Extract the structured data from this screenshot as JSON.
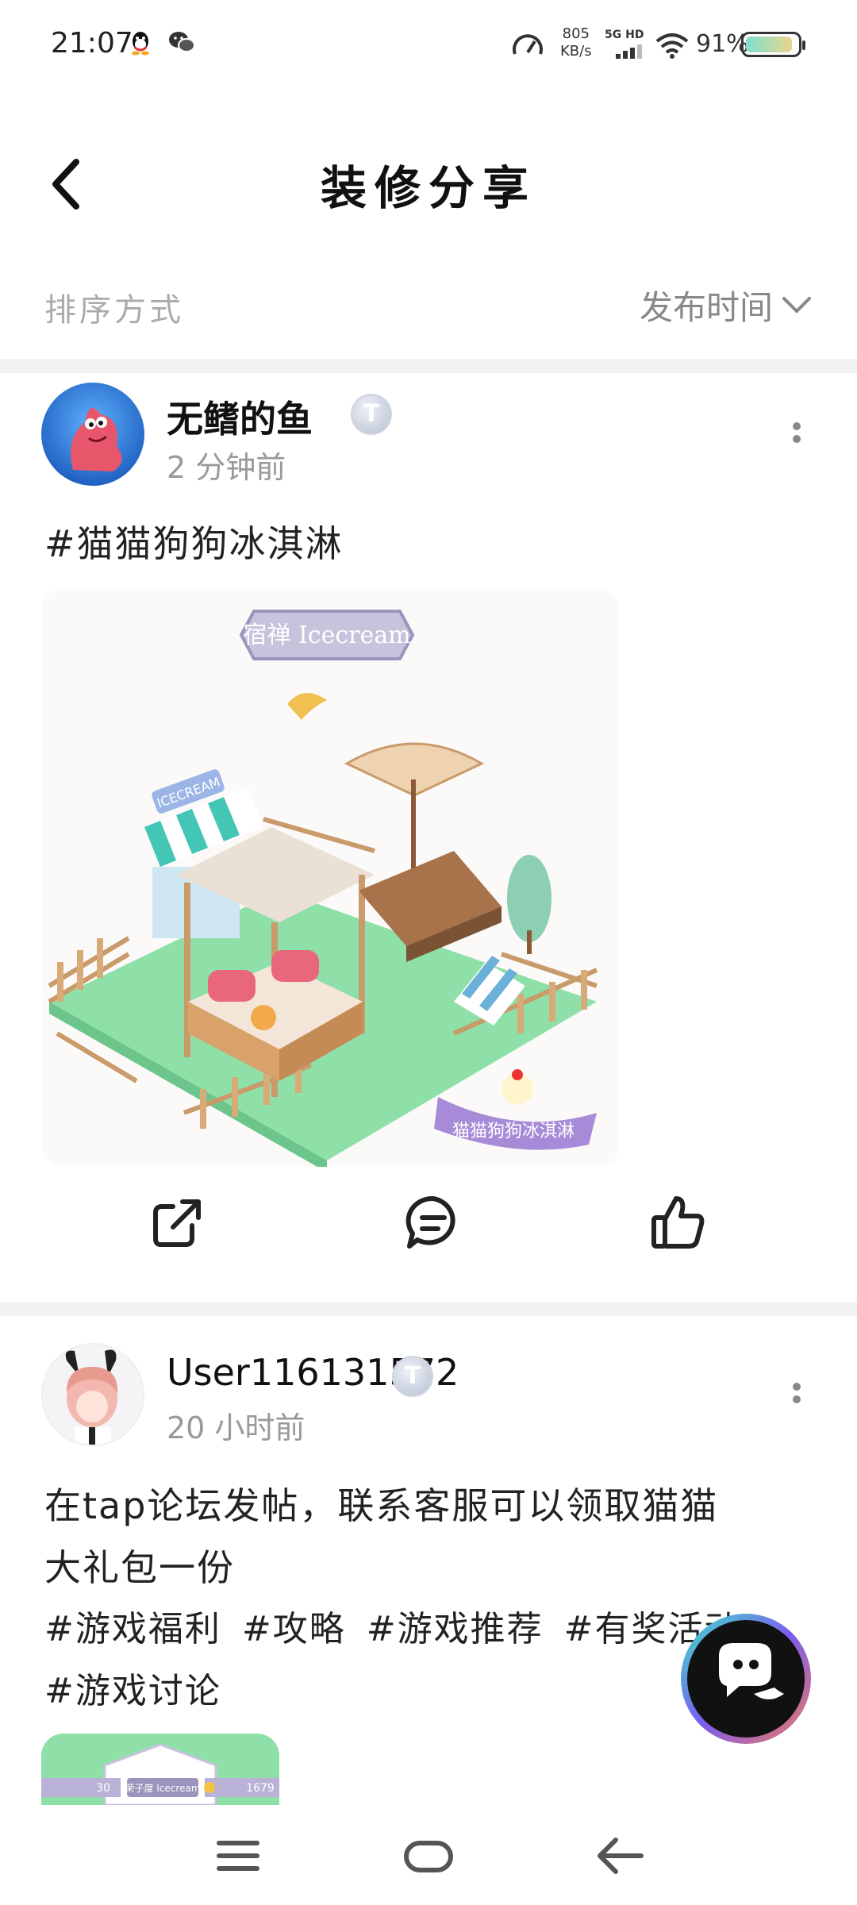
{
  "status_bar": {
    "time": "21:07",
    "net_speed_value": "805",
    "net_speed_unit": "KB/s",
    "signal_label": "5G HD",
    "battery_percent": "91%",
    "battery_level": 0.91,
    "icons": [
      "qq-icon",
      "wechat-icon",
      "speed-icon",
      "signal-icon",
      "wifi-icon",
      "battery-icon"
    ]
  },
  "header": {
    "title": "装修分享",
    "back_icon": "chevron-left-icon"
  },
  "sort": {
    "label": "排序方式",
    "selected": "发布时间",
    "icon": "chevron-down-icon"
  },
  "posts": [
    {
      "username": "无鳍的鱼",
      "badge": "T",
      "time_ago": "2 分钟前",
      "text": "#猫猫狗狗冰淇淋",
      "image": {
        "sign_text": "宿禅 Icecream",
        "stand_text": "ICECREAM",
        "ribbon_text": "猫猫狗狗冰淇淋",
        "accent": "#a78bd8"
      },
      "actions": [
        "share-icon",
        "comment-icon",
        "like-icon"
      ]
    },
    {
      "username": "User116131572",
      "badge": "T",
      "time_ago": "20 小时前",
      "text_line1": "在tap论坛发帖，联系客服可以领取猫猫",
      "text_line2": "大礼包一份",
      "tags": [
        "#游戏福利",
        "#攻略",
        "#游戏推荐",
        "#有奖活动",
        "#游戏讨论"
      ],
      "thumb": {
        "left_num": "30",
        "sign_text": "荣子度 Icecream",
        "right_num": "1679"
      }
    }
  ],
  "colors": {
    "divider": "#f1f2f4",
    "muted_text": "#999999",
    "grass": "#8ee0a8",
    "fab_bg": "#111111"
  }
}
